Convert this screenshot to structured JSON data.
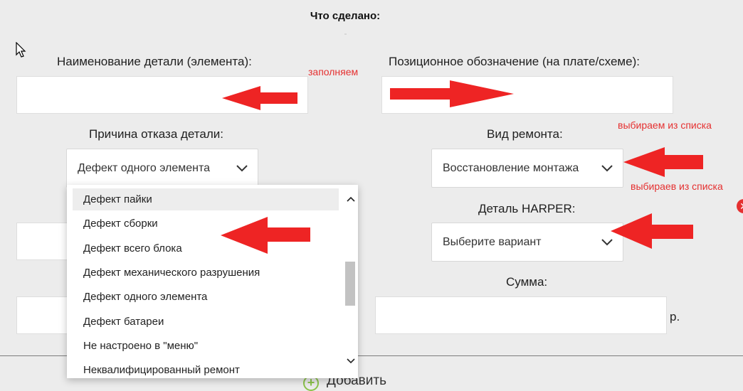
{
  "header": {
    "title": "Что сделано:"
  },
  "form": {
    "part_name_label": "Наименование детали (элемента):",
    "part_name_value": "",
    "position_label": "Позиционное обозначение (на плате/схеме):",
    "position_value": "",
    "failure_reason_label": "Причина отказа детали:",
    "failure_reason_value": "Дефект одного элемента",
    "repair_type_label": "Вид ремонта:",
    "repair_type_value": "Восстановление монтажа",
    "harper_part_label": "Деталь HARPER:",
    "harper_part_value": "Выберите вариант",
    "sum_label": "Сумма:",
    "sum_value": "",
    "currency": "р.",
    "add_label": "Добавить"
  },
  "annotations": {
    "fill_note": "заполняем",
    "choose_note_1": "выбираем из списка",
    "choose_note_2": "выбираев из списка",
    "arrow_color": "#ee2424"
  },
  "dropdown": {
    "options": [
      "Дефект пайки",
      "Дефект сборки",
      "Дефект всего блока",
      "Дефект механического разрушения",
      "Дефект одного элемента",
      "Дефект батареи",
      "Не настроено в \"меню\"",
      "Неквалифицированный ремонт"
    ],
    "highlighted_index": 0
  },
  "colors": {
    "accent_green": "#8bc34a",
    "error_red": "#e53030"
  }
}
